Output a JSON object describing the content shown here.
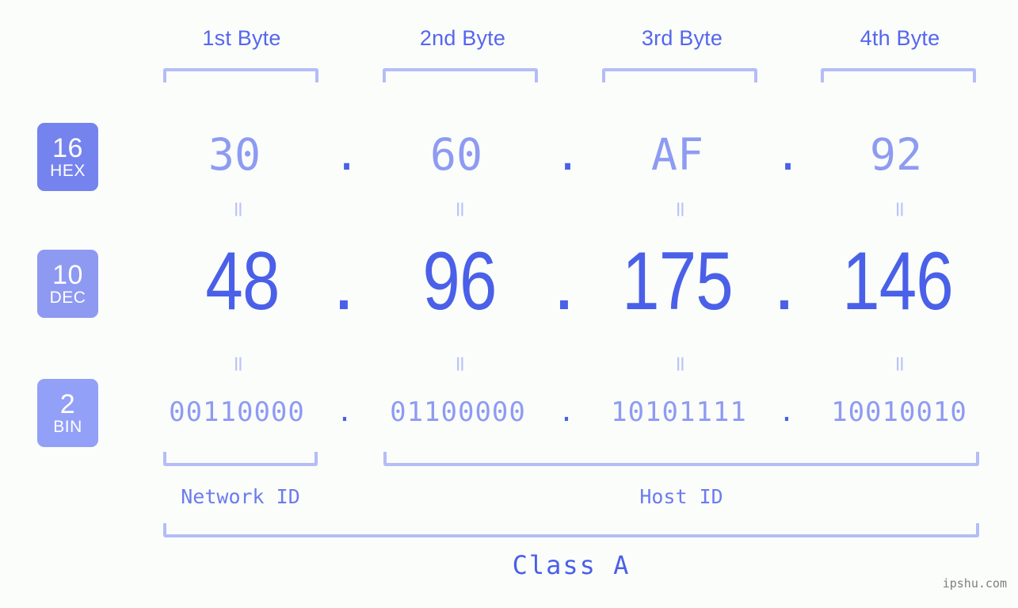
{
  "background_color": "#fbfdfa",
  "accent_color": "#4a60e8",
  "light_accent_color": "#8e9bf3",
  "bracket_color": "#b4bdf7",
  "byte_headers": [
    {
      "label": "1st Byte"
    },
    {
      "label": "2nd Byte"
    },
    {
      "label": "3rd Byte"
    },
    {
      "label": "4th Byte"
    }
  ],
  "bases": [
    {
      "number": "16",
      "name": "HEX",
      "color": "#7583ef"
    },
    {
      "number": "10",
      "name": "DEC",
      "color": "#8e99f2"
    },
    {
      "number": "2",
      "name": "BIN",
      "color": "#93a0f7"
    }
  ],
  "separators": {
    "dot": ".",
    "equals": "="
  },
  "rows": {
    "hex": {
      "values": [
        "30",
        "60",
        "AF",
        "92"
      ]
    },
    "dec": {
      "values": [
        "48",
        "96",
        "175",
        "146"
      ]
    },
    "bin": {
      "values": [
        "00110000",
        "01100000",
        "10101111",
        "10010010"
      ]
    }
  },
  "sections": {
    "network_id": "Network ID",
    "host_id": "Host ID",
    "class": "Class A"
  },
  "watermark": "ipshu.com"
}
